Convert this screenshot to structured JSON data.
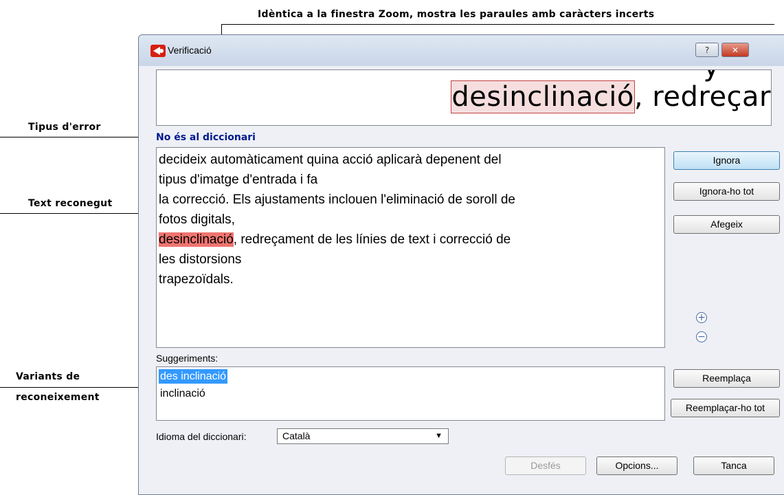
{
  "callouts": {
    "zoom_note": "Idèntica a la finestra Zoom, mostra les paraules amb caràcters incerts",
    "error_type": "Tipus d'error",
    "recognized_text": "Text reconegut",
    "variants_line1": "Variants de",
    "variants_line2": "reconeixement"
  },
  "window": {
    "title": "Verificació",
    "help_button": "?",
    "close_button": "✕"
  },
  "zoom": {
    "partial_char": "y",
    "word": "desinclinació",
    "rest": ", redreçar"
  },
  "error_type": "No és al diccionari",
  "text_lines": [
    "decideix automàticament quina acció aplicarà depenent del",
    "tipus d'imatge d'entrada i fa",
    "la correcció. Els ajustaments inclouen l'eliminació de soroll de",
    "fotos digitals,",
    "desinclinació",
    ", redreçament de les línies de text i correcció de",
    "les distorsions",
    "trapezoïdals."
  ],
  "buttons": {
    "ignore": "Ignora",
    "ignore_all": "Ignora-ho tot",
    "add": "Afegeix",
    "replace": "Reemplaça",
    "replace_all": "Reemplaçar-ho tot",
    "undo": "Desfés",
    "options": "Opcions...",
    "close": "Tanca"
  },
  "zoom_controls": {
    "zoom_in": "+",
    "zoom_out": "−"
  },
  "suggestions": {
    "label": "Suggeriments:",
    "items": [
      "des inclinació",
      "inclinació"
    ],
    "selected_index": 0
  },
  "dictionary": {
    "label": "Idioma del diccionari:",
    "selected": "Català"
  },
  "colors": {
    "highlight": "#ef7470",
    "error_text": "#001a8c",
    "selection": "#3399ff"
  }
}
